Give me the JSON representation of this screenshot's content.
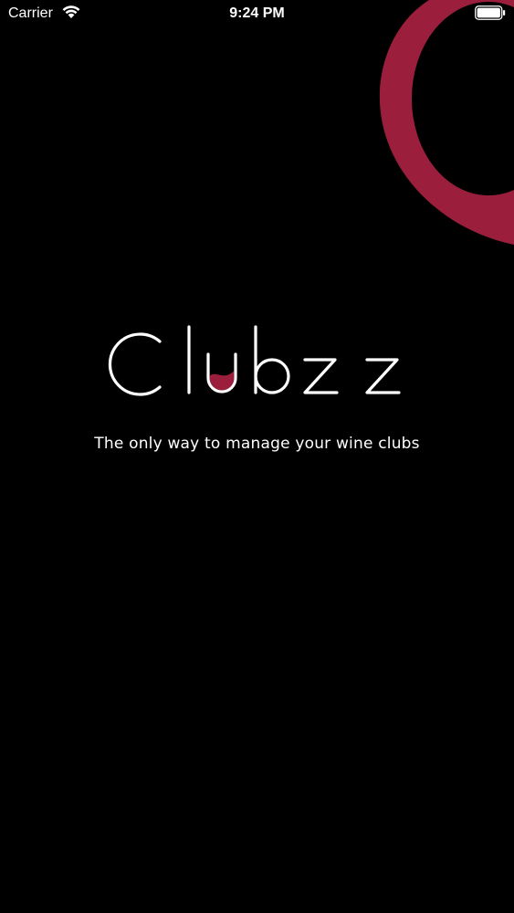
{
  "status_bar": {
    "carrier": "Carrier",
    "time": "9:24 PM"
  },
  "brand": {
    "logo_text": "Clubzz",
    "tagline": "The only way to manage your wine clubs",
    "accent_color": "#9b1f3d"
  },
  "icons": {
    "wifi": "wifi-icon",
    "battery": "battery-icon"
  }
}
